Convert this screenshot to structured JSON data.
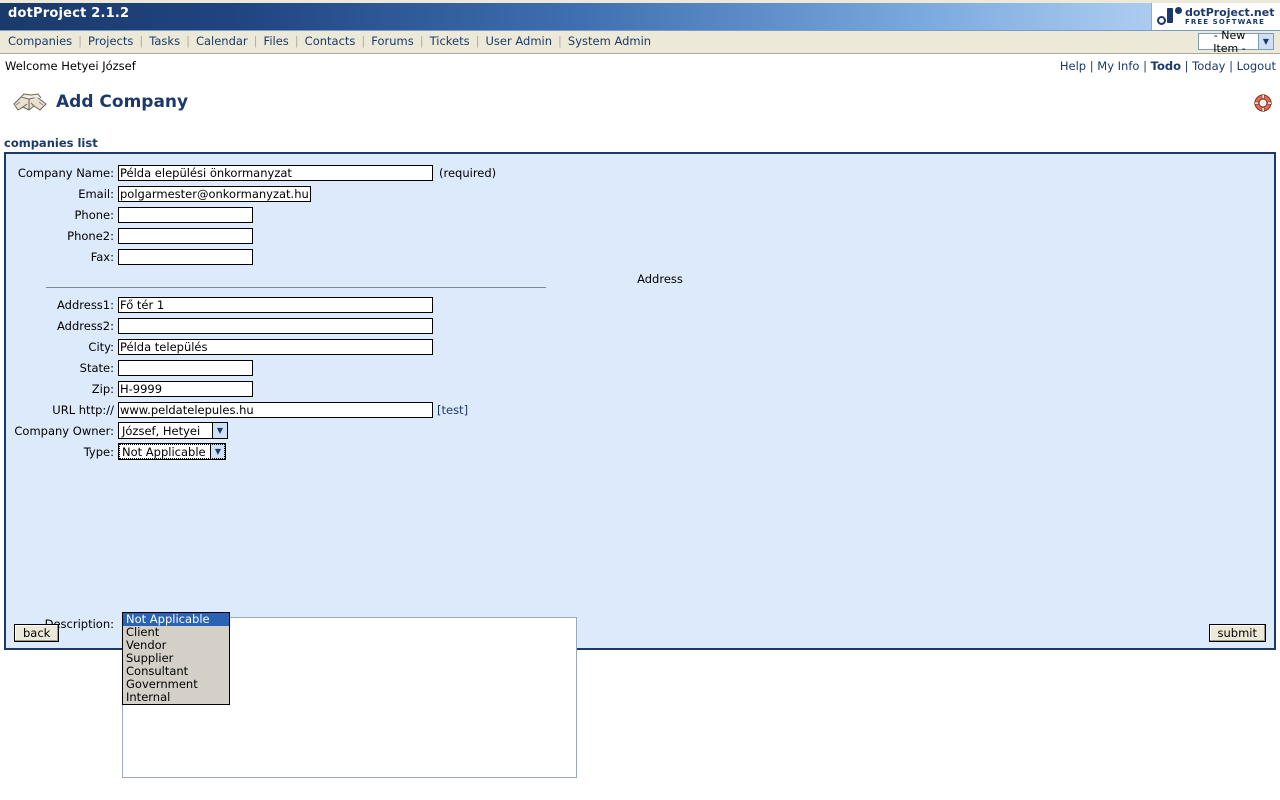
{
  "window": {
    "app_title": "dotProject 2.1.2",
    "brand": {
      "name": "dotProject.net",
      "tagline": "FREE SOFTWARE"
    }
  },
  "menu": {
    "items": [
      "Companies",
      "Projects",
      "Tasks",
      "Calendar",
      "Files",
      "Contacts",
      "Forums",
      "Tickets",
      "User Admin",
      "System Admin"
    ],
    "new_item_select": "- New Item -"
  },
  "userbar": {
    "welcome": "Welcome Hetyei József",
    "links": [
      "Help",
      "My Info",
      "Todo",
      "Today",
      "Logout"
    ],
    "active_link": "Todo"
  },
  "page": {
    "title": "Add Company",
    "icon": "handshake-icon",
    "help_icon": "lifering-icon",
    "breadcrumb": "companies list"
  },
  "form": {
    "fields": [
      {
        "label": "Company Name:",
        "value": "Példa elepülési önkormanyzat",
        "width": "w315",
        "suffix": "(required)"
      },
      {
        "label": "Email:",
        "value": "polgarmester@onkormanyzat.hu",
        "width": "w193",
        "suffix": ""
      },
      {
        "label": "Phone:",
        "value": "",
        "width": "w135",
        "suffix": ""
      },
      {
        "label": "Phone2:",
        "value": "",
        "width": "w135",
        "suffix": ""
      },
      {
        "label": "Fax:",
        "value": "",
        "width": "w135",
        "suffix": ""
      }
    ],
    "address_heading": "Address",
    "address_fields": [
      {
        "label": "Address1:",
        "value": "Fő tér 1",
        "width": "w315",
        "suffix": ""
      },
      {
        "label": "Address2:",
        "value": "",
        "width": "w315",
        "suffix": ""
      },
      {
        "label": "City:",
        "value": "Példa település",
        "width": "w315",
        "suffix": ""
      },
      {
        "label": "State:",
        "value": "",
        "width": "w135",
        "suffix": ""
      },
      {
        "label": "Zip:",
        "value": "H-9999",
        "width": "w135",
        "suffix": ""
      },
      {
        "label": "URL http://",
        "value": "www.peldatelepules.hu",
        "width": "w315",
        "suffix_link": "[test]"
      }
    ],
    "owner": {
      "label": "Company Owner:",
      "value": "József, Hetyei"
    },
    "type": {
      "label": "Type:",
      "value": "Not Applicable",
      "expanded": true,
      "options": [
        "Not Applicable",
        "Client",
        "Vendor",
        "Supplier",
        "Consultant",
        "Government",
        "Internal"
      ],
      "selected_option": "Not Applicable"
    },
    "description": {
      "label": "Description:",
      "value": ""
    },
    "buttons": {
      "back": "back",
      "submit": "submit"
    }
  },
  "colors": {
    "header_dark": "#1b3a6b",
    "header_light": "#b7d3f2",
    "panel_bg": "#ddeafc",
    "panel_border": "#1b3a6b",
    "menu_bg": "#ece9d8",
    "highlight": "#2a63b6"
  }
}
